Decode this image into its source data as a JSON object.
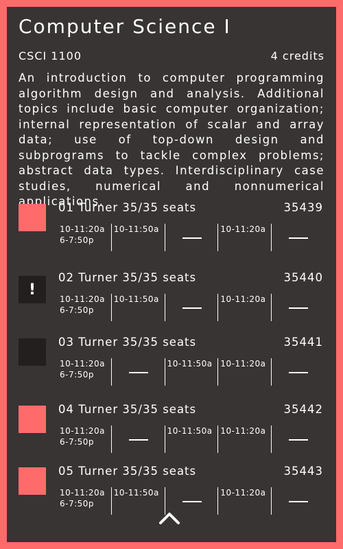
{
  "course": {
    "title": "Computer Science I",
    "code": "CSCI 1100",
    "credits": "4 credits",
    "description": "An introduction to computer programming algorithm design and analysis. Additional topics include basic computer organization; internal representation of scalar and array data; use of top-down design and subprograms to tackle complex problems; abstract data types. Interdisciplinary case studies, numerical and nonnumerical applications."
  },
  "sections": [
    {
      "status": "filled",
      "status_symbol": "",
      "label": "01 Turner 35/35 seats",
      "crn": "35439",
      "days": [
        [
          "10-11:20a",
          "6-7:50p"
        ],
        [
          "10-11:50a"
        ],
        [],
        [
          "10-11:20a"
        ],
        []
      ]
    },
    {
      "status": "dark",
      "status_symbol": "!",
      "label": "02 Turner 35/35 seats",
      "crn": "35440",
      "days": [
        [
          "10-11:20a",
          "6-7:50p"
        ],
        [
          "10-11:50a"
        ],
        [],
        [
          "10-11:20a"
        ],
        []
      ]
    },
    {
      "status": "dark",
      "status_symbol": "",
      "label": "03 Turner 35/35 seats",
      "crn": "35441",
      "days": [
        [
          "10-11:20a",
          "6-7:50p"
        ],
        [],
        [
          "10-11:50a"
        ],
        [
          "10-11:20a"
        ],
        []
      ]
    },
    {
      "status": "filled",
      "status_symbol": "",
      "label": "04 Turner 35/35 seats",
      "crn": "35442",
      "days": [
        [
          "10-11:20a",
          "6-7:50p"
        ],
        [],
        [
          "10-11:50a"
        ],
        [
          "10-11:20a"
        ],
        []
      ]
    },
    {
      "status": "filled",
      "status_symbol": "",
      "label": "05 Turner 35/35 seats",
      "crn": "35443",
      "days": [
        [
          "10-11:20a",
          "6-7:50p"
        ],
        [
          "10-11:50a"
        ],
        [],
        [
          "10-11:20a"
        ],
        []
      ]
    }
  ],
  "colors": {
    "accent": "#ff6b6b",
    "panel": "#383433",
    "dark_box": "#231f1e"
  },
  "icons": {
    "collapse": "chevron-up-icon",
    "warning": "exclamation-icon"
  }
}
